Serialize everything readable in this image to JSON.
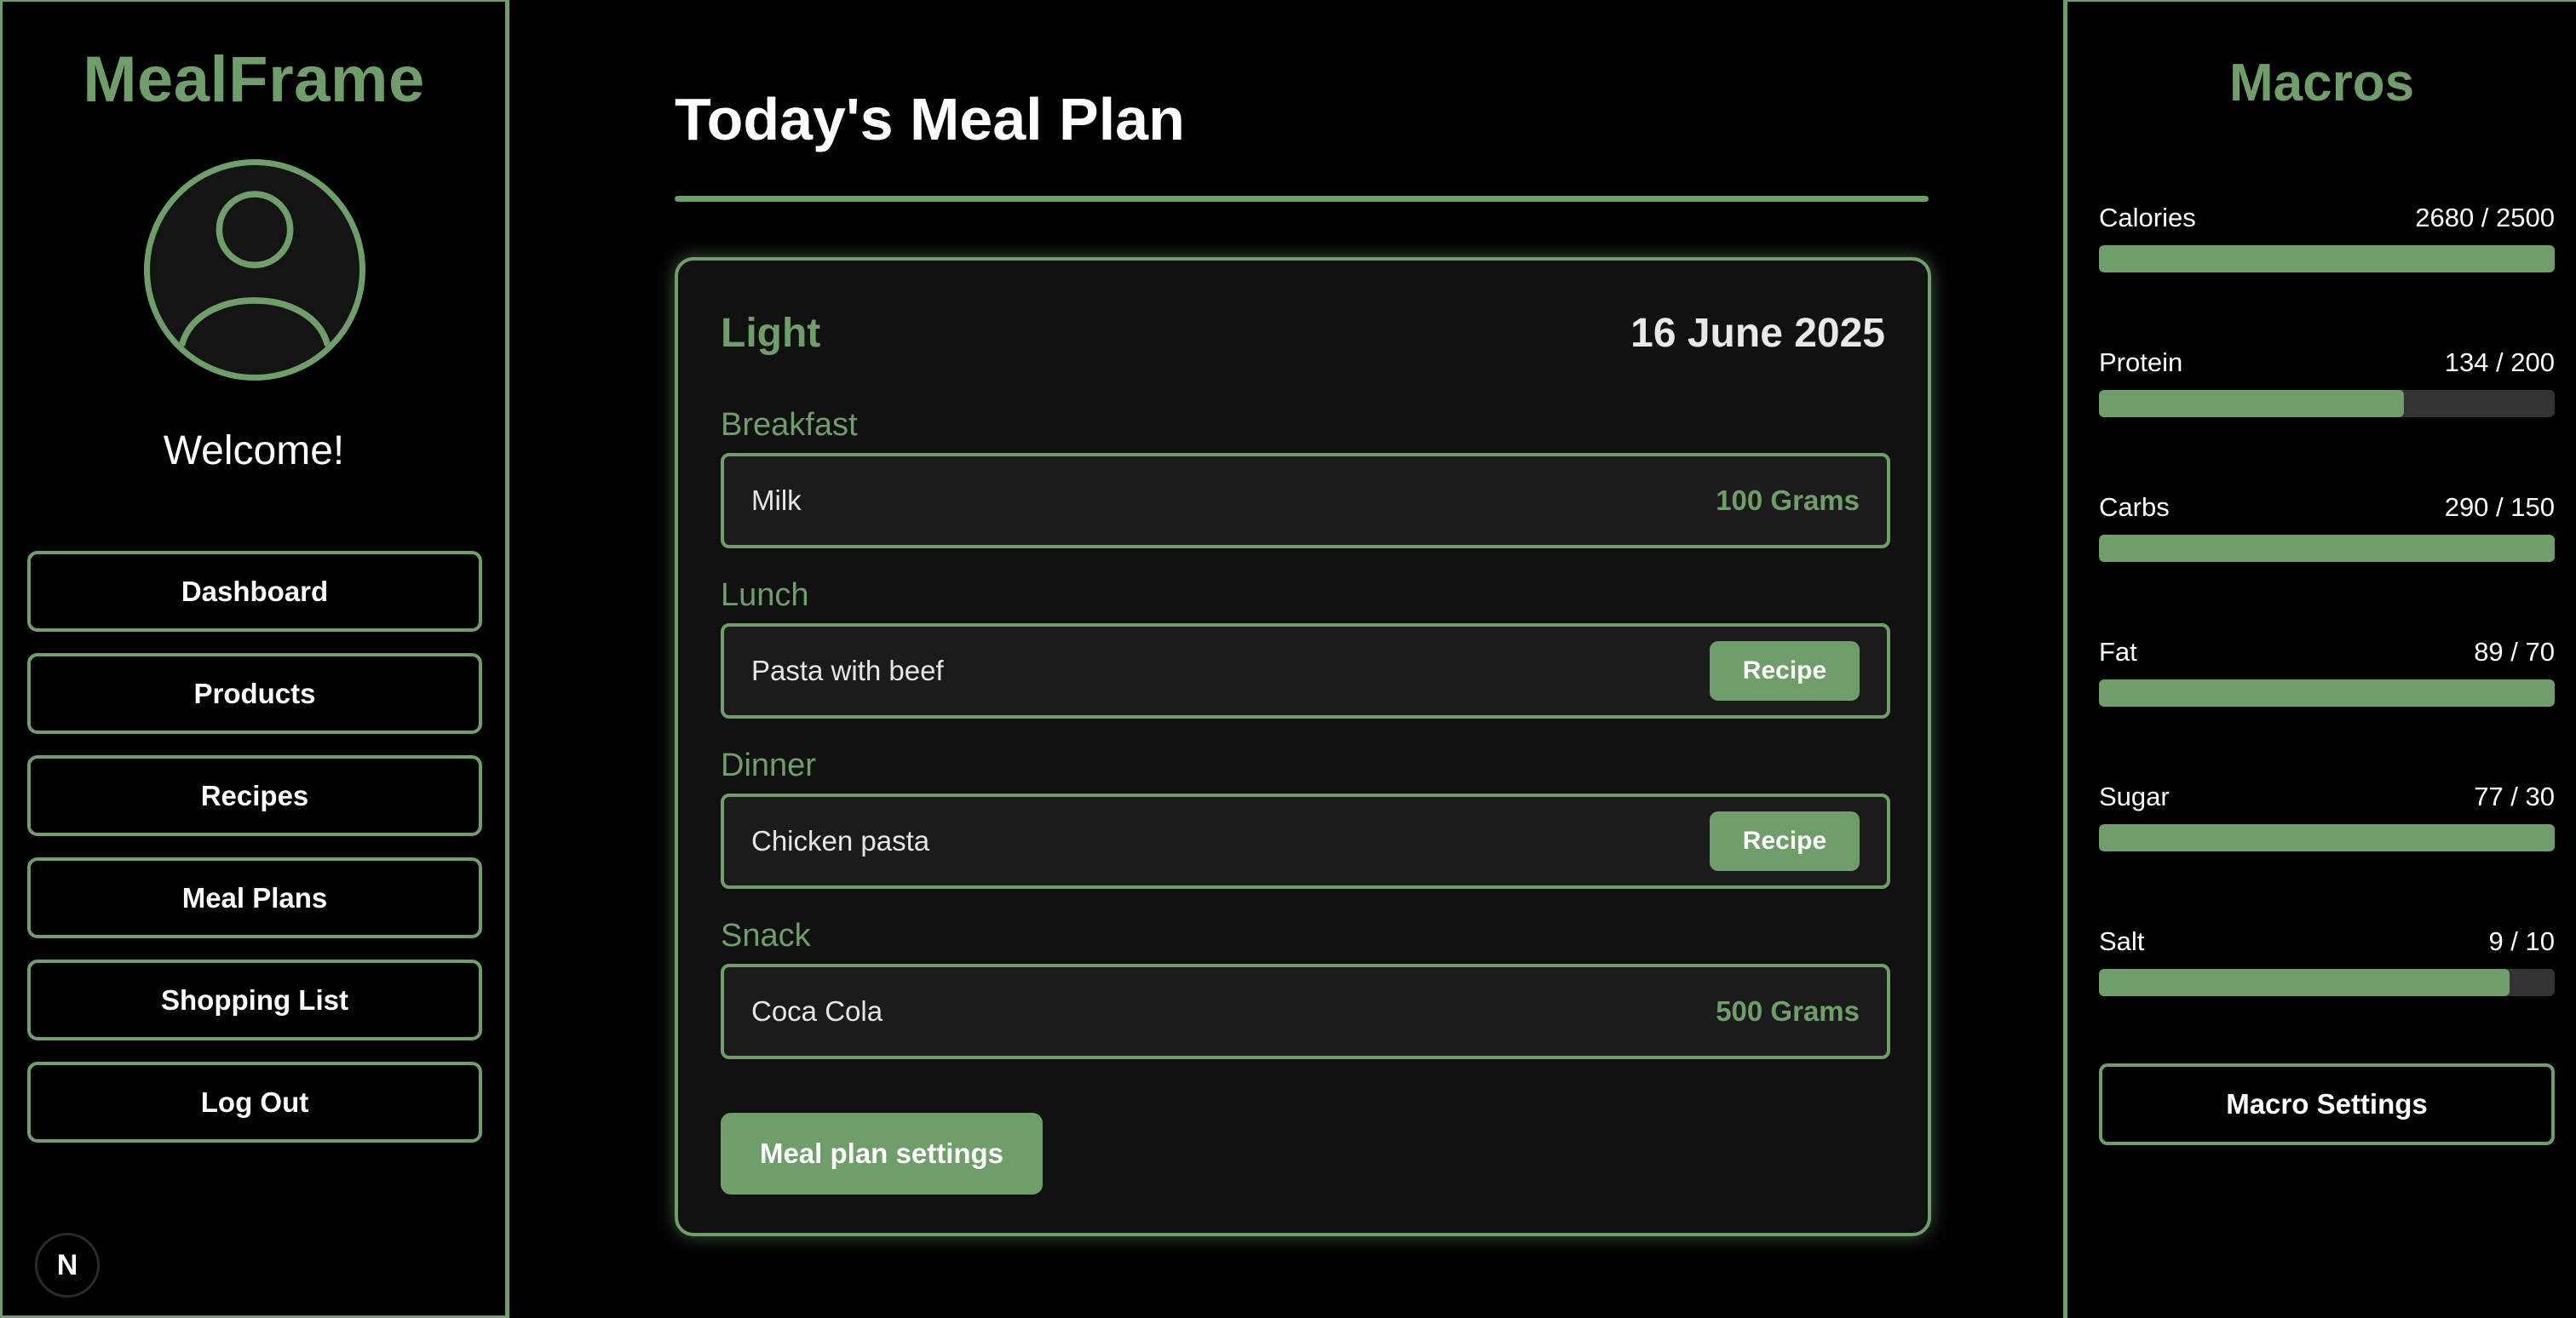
{
  "sidebar": {
    "brand": "MealFrame",
    "avatar_icon": "user-avatar-icon",
    "welcome": "Welcome!",
    "nav": [
      {
        "label": "Dashboard"
      },
      {
        "label": "Products"
      },
      {
        "label": "Recipes"
      },
      {
        "label": "Meal Plans"
      },
      {
        "label": "Shopping List"
      },
      {
        "label": "Log Out"
      }
    ],
    "next_badge": "N"
  },
  "main": {
    "title": "Today's Meal Plan",
    "plan": {
      "name": "Light",
      "date": "16 June 2025",
      "meals": [
        {
          "label": "Breakfast",
          "item": "Milk",
          "quantity": "100 Grams"
        },
        {
          "label": "Lunch",
          "item": "Pasta with beef",
          "action": "Recipe"
        },
        {
          "label": "Dinner",
          "item": "Chicken pasta",
          "action": "Recipe"
        },
        {
          "label": "Snack",
          "item": "Coca Cola",
          "quantity": "500 Grams"
        }
      ],
      "settings_label": "Meal plan settings"
    }
  },
  "macros": {
    "title": "Macros",
    "items": [
      {
        "name": "Calories",
        "value": "2680 / 2500",
        "progress": 1.0
      },
      {
        "name": "Protein",
        "value": "134 / 200",
        "progress": 0.67
      },
      {
        "name": "Carbs",
        "value": "290 / 150",
        "progress": 1.0
      },
      {
        "name": "Fat",
        "value": "89 / 70",
        "progress": 1.0
      },
      {
        "name": "Sugar",
        "value": "77 / 30",
        "progress": 1.0
      },
      {
        "name": "Salt",
        "value": "9 / 10",
        "progress": 0.9
      }
    ],
    "settings_label": "Macro Settings"
  },
  "colors": {
    "accent": "#6f9e6a",
    "background": "#000000",
    "card": "#111111",
    "track": "#333333"
  }
}
